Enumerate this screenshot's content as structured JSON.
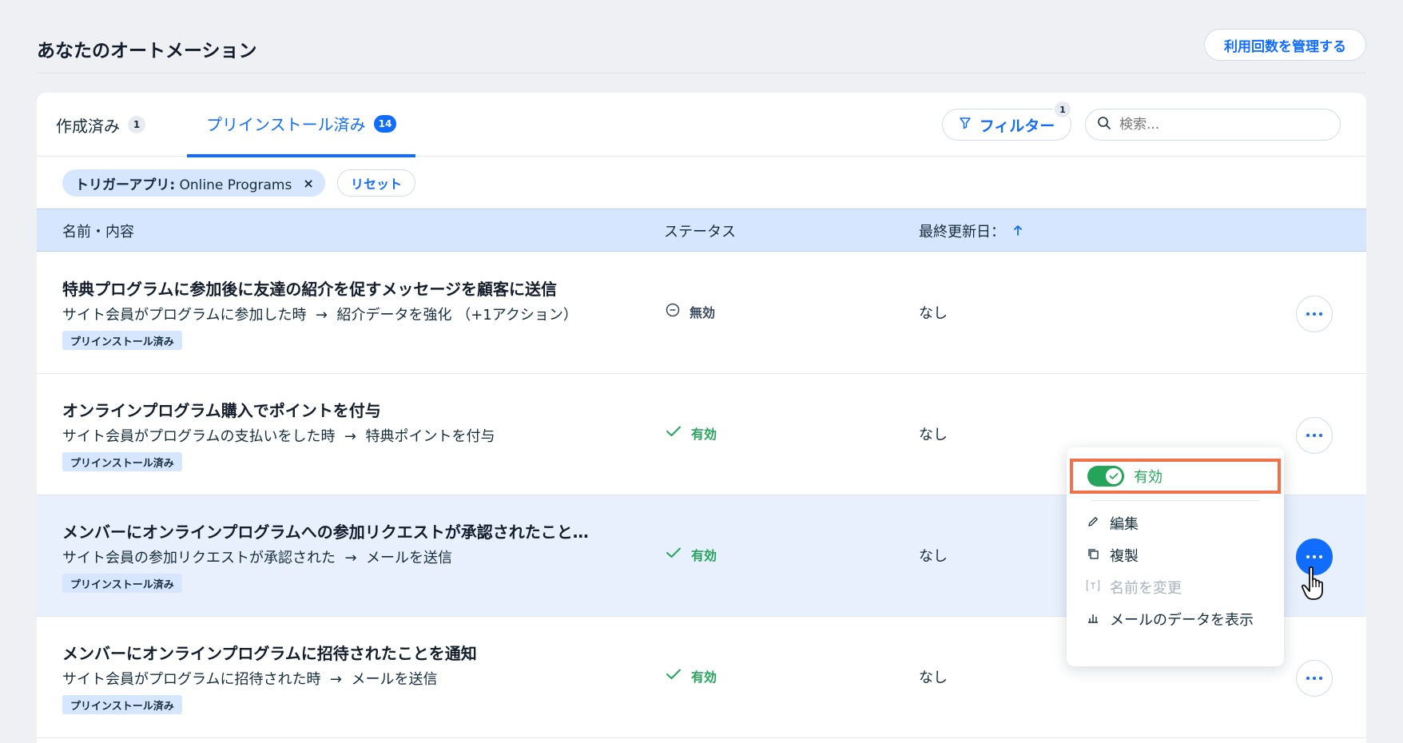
{
  "page": {
    "title": "あなたのオートメーション",
    "manage_button": "利用回数を管理する"
  },
  "tabs": [
    {
      "label": "作成済み",
      "count": "1"
    },
    {
      "label": "プリインストール済み",
      "count": "14"
    }
  ],
  "filter": {
    "label": "フィルター",
    "badge": "1"
  },
  "search": {
    "placeholder": "検索..."
  },
  "active_filter": {
    "key": "トリガーアプリ:",
    "value": "Online Programs",
    "close": "×"
  },
  "reset_button": "リセット",
  "table": {
    "columns": {
      "name": "名前・内容",
      "status": "ステータス",
      "updated": "最終更新日：",
      "sort_icon": "arrow-up-icon"
    },
    "rows": [
      {
        "title": "特典プログラムに参加後に友達の紹介を促すメッセージを顧客に送信",
        "trigger": "サイト会員がプログラムに参加した時",
        "arrow": "→",
        "action": "紹介データを強化 （+1アクション）",
        "tag": "プリインストール済み",
        "status": "無効",
        "status_type": "inactive",
        "updated": "なし"
      },
      {
        "title": "オンラインプログラム購入でポイントを付与",
        "trigger": "サイト会員がプログラムの支払いをした時",
        "arrow": "→",
        "action": "特典ポイントを付与",
        "tag": "プリインストール済み",
        "status": "有効",
        "status_type": "active",
        "updated": "なし"
      },
      {
        "title": "メンバーにオンラインプログラムへの参加リクエストが承認されたこと…",
        "trigger": "サイト会員の参加リクエストが承認された",
        "arrow": "→",
        "action": "メールを送信",
        "tag": "プリインストール済み",
        "status": "有効",
        "status_type": "active",
        "updated": "なし"
      },
      {
        "title": "メンバーにオンラインプログラムに招待されたことを通知",
        "trigger": "サイト会員がプログラムに招待された時",
        "arrow": "→",
        "action": "メールを送信",
        "tag": "プリインストール済み",
        "status": "有効",
        "status_type": "active",
        "updated": "なし"
      }
    ]
  },
  "dropdown": {
    "toggle_label": "有効",
    "items": [
      {
        "label": "編集",
        "icon": "pencil-icon",
        "disabled": false
      },
      {
        "label": "複製",
        "icon": "duplicate-icon",
        "disabled": false
      },
      {
        "label": "名前を変更",
        "icon": "rename-icon",
        "disabled": true
      },
      {
        "label": "メールのデータを表示",
        "icon": "bar-chart-icon",
        "disabled": false
      }
    ]
  },
  "colors": {
    "accent": "#116dff",
    "success": "#25a55a",
    "highlight_border": "#f0714a",
    "header_bg": "#d6e6fe"
  }
}
